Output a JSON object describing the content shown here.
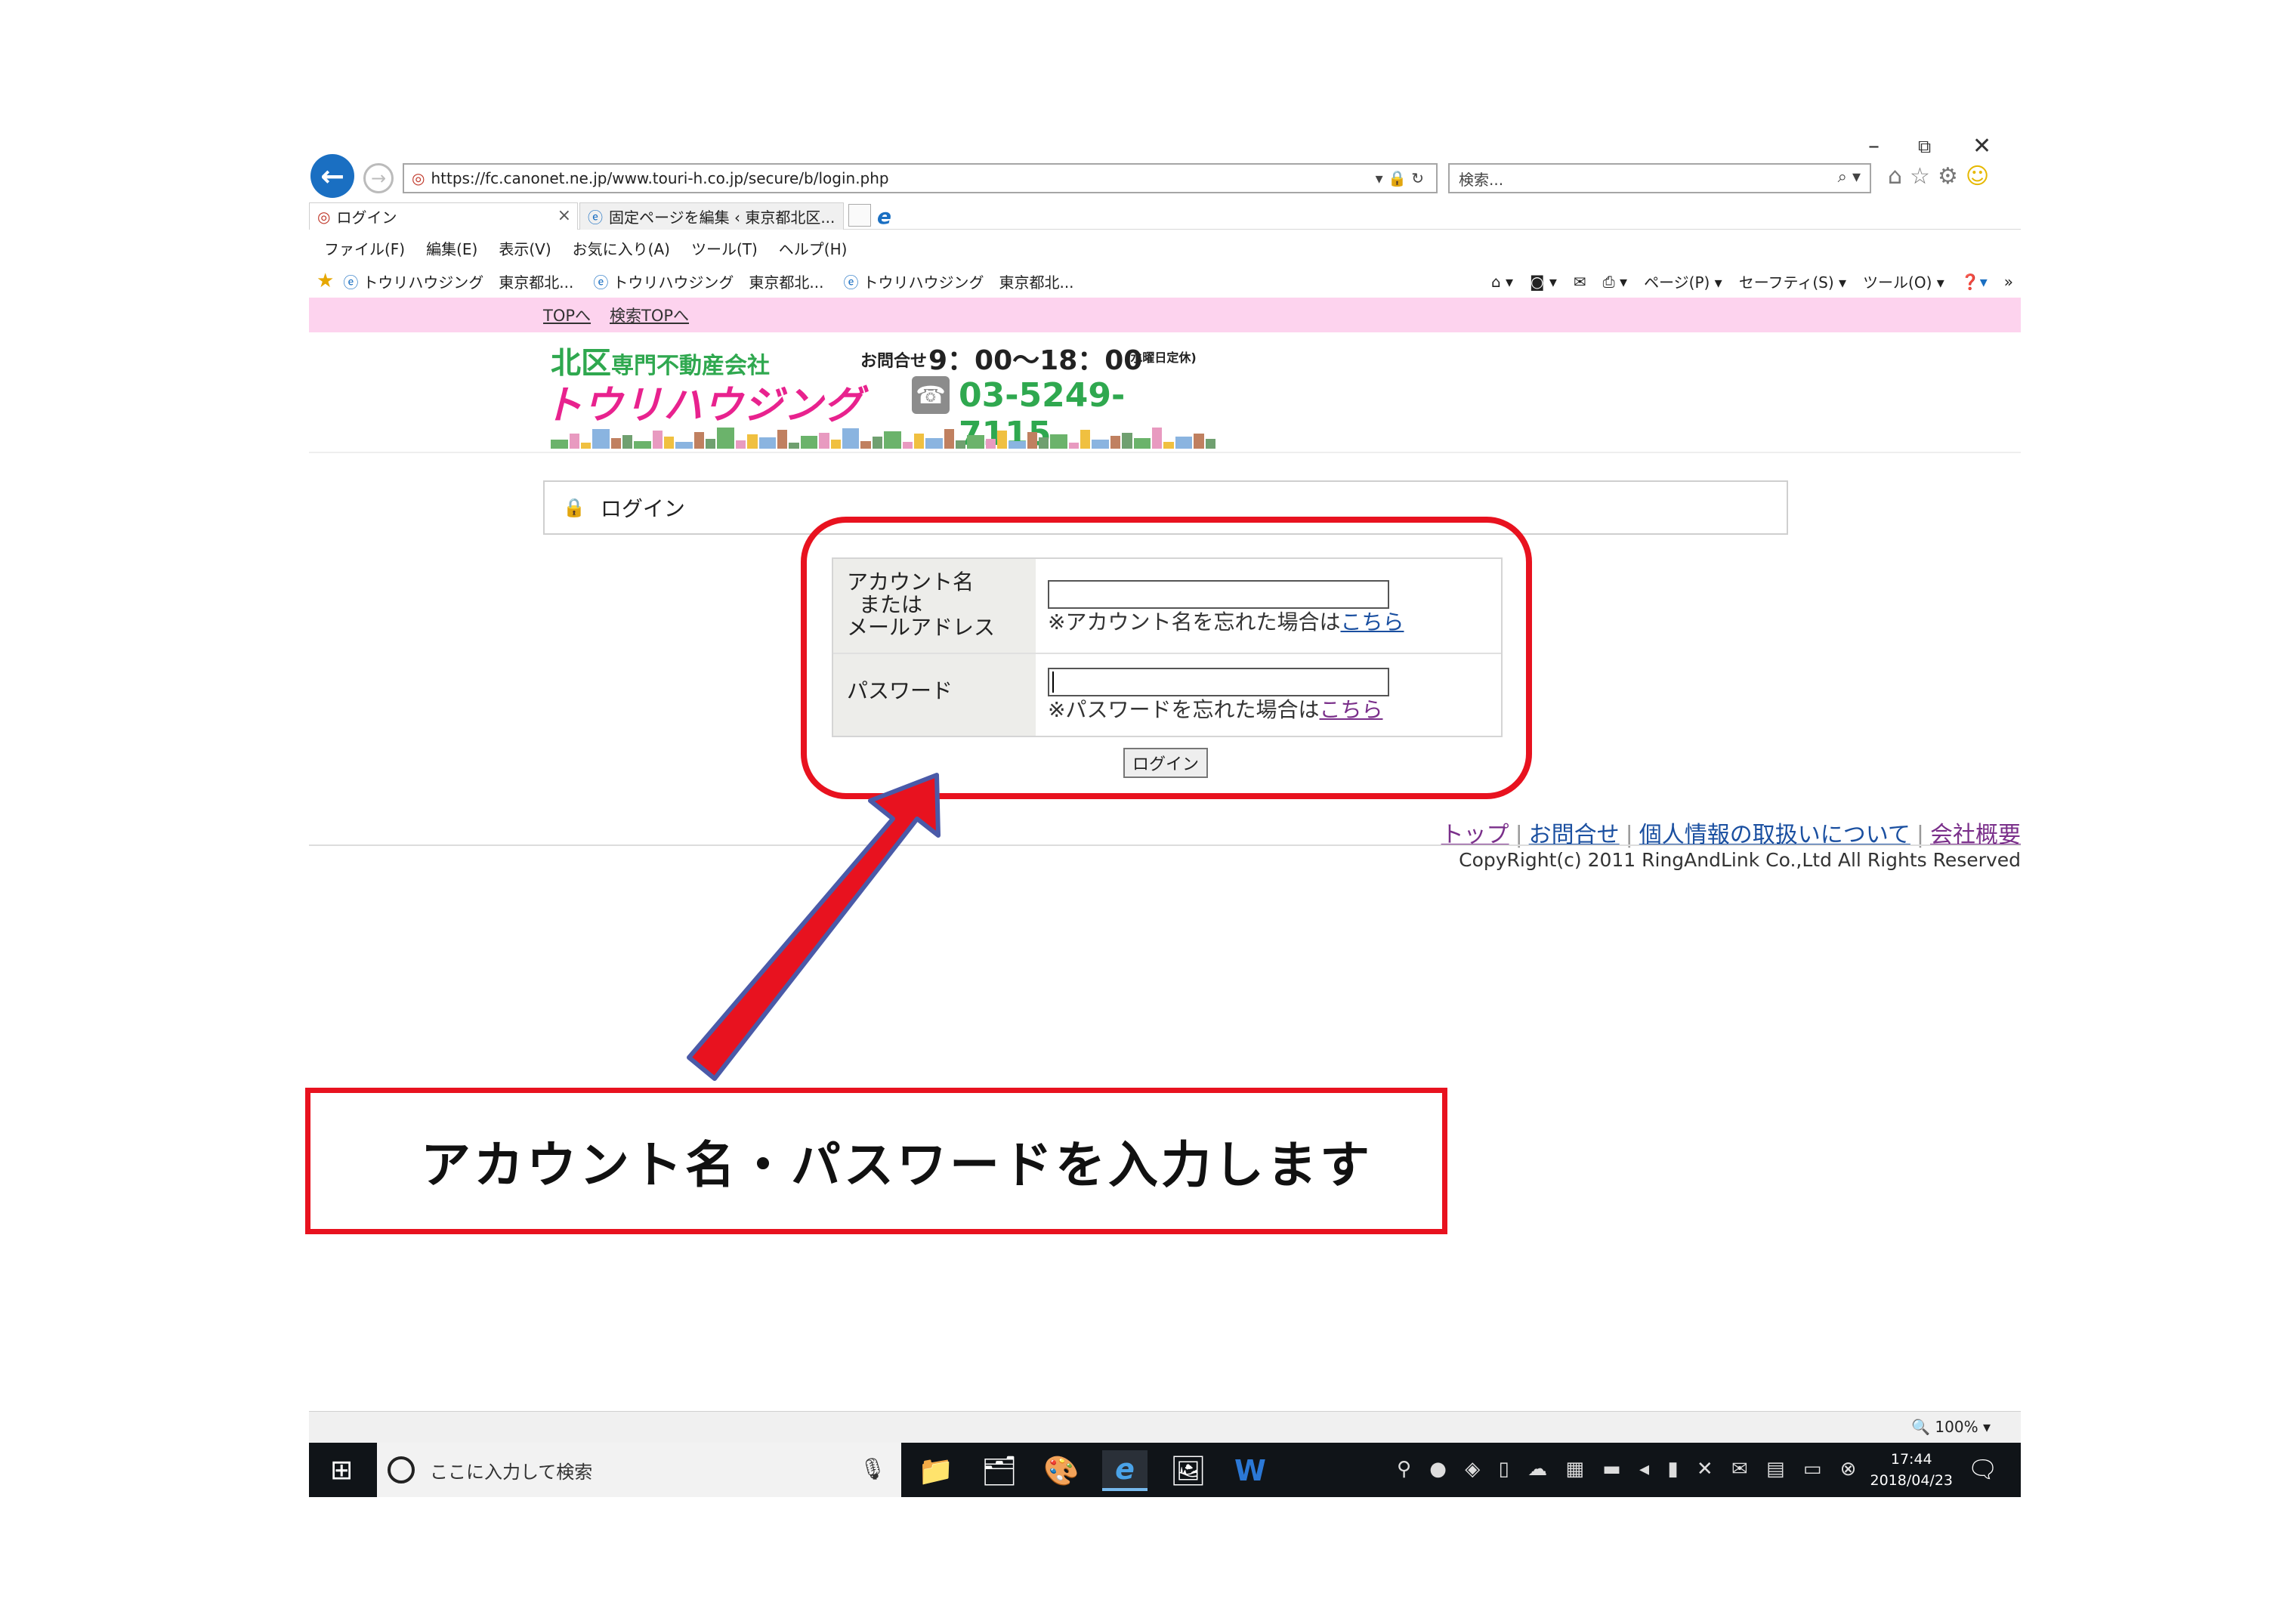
{
  "browser": {
    "window_controls": [
      "–",
      "⧉",
      "✕"
    ],
    "address": "https://fc.canonet.ne.jp/www.touri-h.co.jp/secure/b/login.php",
    "search_placeholder": "検索...",
    "tabs": [
      {
        "label": "ログイン"
      },
      {
        "label": "固定ページを編集 ‹ 東京都北区..."
      }
    ],
    "menu": [
      "ファイル(F)",
      "編集(E)",
      "表示(V)",
      "お気に入り(A)",
      "ツール(T)",
      "ヘルプ(H)"
    ],
    "favorites": [
      "トウリハウジング　東京都北...",
      "トウリハウジング　東京都北...",
      "トウリハウジング　東京都北..."
    ],
    "commands": {
      "page": "ページ(P) ▾",
      "safety": "セーフティ(S) ▾",
      "tools": "ツール(O) ▾"
    },
    "zoom": "100%"
  },
  "page": {
    "nav_links": [
      "TOPへ",
      "検索TOPへ"
    ],
    "logo": {
      "area": "北区",
      "tagline": "専門不動産会社",
      "hours_label": "お問合せ",
      "hours": "9：00～18：00",
      "closed": "(水曜日定休)",
      "brand": "トウリハウジング",
      "phone": "03-5249-7115"
    },
    "section_title": "ログイン",
    "form": {
      "account_label": [
        "アカウント名",
        "または",
        "メールアドレス"
      ],
      "account_hint": "※アカウント名を忘れた場合は",
      "password_label": "パスワード",
      "password_hint": "※パスワードを忘れた場合は",
      "link_text": "こちら",
      "submit": "ログイン"
    },
    "footer": {
      "links": [
        "トップ",
        "お問合せ",
        "個人情報の取扱いについて",
        "会社概要"
      ],
      "copyright": "CopyRight(c) 2011 RingAndLink Co.,Ltd All Rights Reserved"
    }
  },
  "taskbar": {
    "search_placeholder": "ここに入力して検索",
    "time": "17:44",
    "date": "2018/04/23"
  },
  "annotation": {
    "caption": "アカウント名・パスワードを入力します",
    "accent": "#e8121f"
  },
  "colors": {
    "pink_bar": "#fdd3ee",
    "brand_pink": "#e8228e",
    "brand_green": "#2fa84f"
  }
}
